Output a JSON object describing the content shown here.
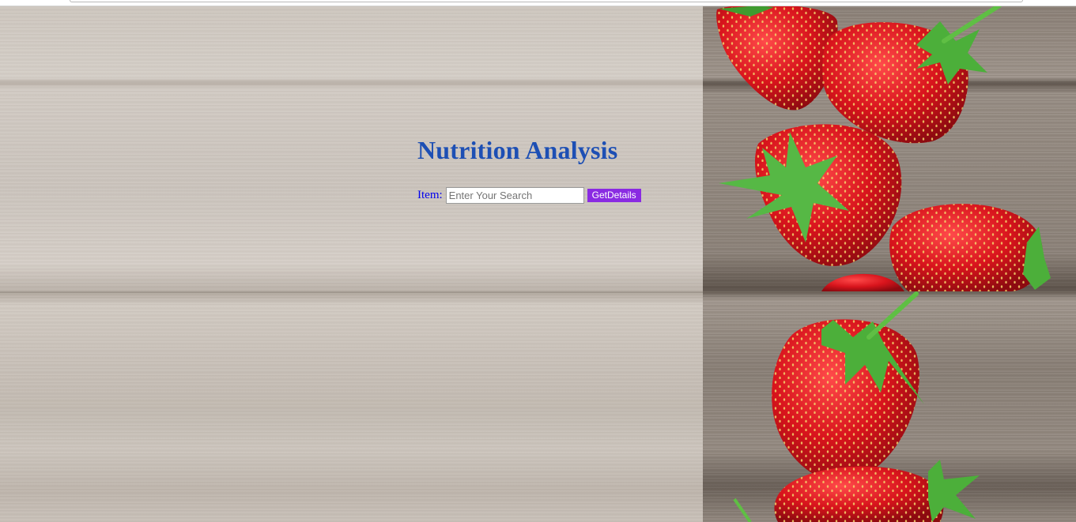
{
  "page": {
    "title": "Nutrition Analysis"
  },
  "search": {
    "label": "Item:",
    "placeholder": "Enter Your Search",
    "value": "",
    "button_label": "GetDetails"
  },
  "colors": {
    "title": "#1d4fb4",
    "label": "#0000ee",
    "button": "#8a2be2"
  },
  "background": {
    "image": "wood-with-strawberries"
  }
}
